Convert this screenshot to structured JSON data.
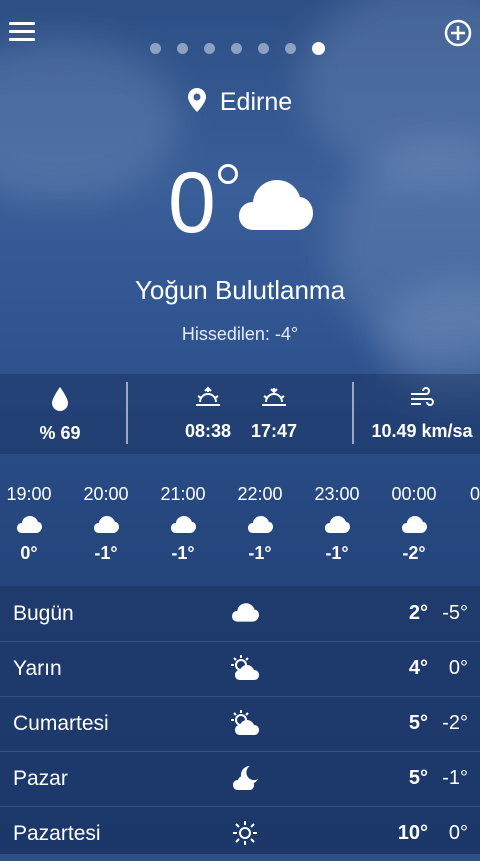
{
  "location": {
    "city": "Edirne"
  },
  "current": {
    "temperature": "0",
    "condition": "Yoğun Bulutlanma",
    "feels_like": "Hissedilen: -4°",
    "icon": "cloud-icon"
  },
  "pager": {
    "count": 7,
    "active_index": 6
  },
  "stats": {
    "humidity": "% 69",
    "sunrise": "08:38",
    "sunset": "17:47",
    "wind": "10.49 km/sa"
  },
  "hourly": [
    {
      "time": "19:00",
      "temp": "0°",
      "icon": "cloud-icon"
    },
    {
      "time": "20:00",
      "temp": "-1°",
      "icon": "cloud-icon"
    },
    {
      "time": "21:00",
      "temp": "-1°",
      "icon": "cloud-icon"
    },
    {
      "time": "22:00",
      "temp": "-1°",
      "icon": "cloud-icon"
    },
    {
      "time": "23:00",
      "temp": "-1°",
      "icon": "cloud-icon"
    },
    {
      "time": "00:00",
      "temp": "-2°",
      "icon": "cloud-icon"
    },
    {
      "time": "0",
      "temp": "",
      "icon": ""
    }
  ],
  "daily": [
    {
      "day": "Bugün",
      "hi": "2°",
      "lo": "-5°",
      "icon": "cloud-icon"
    },
    {
      "day": "Yarın",
      "hi": "4°",
      "lo": "0°",
      "icon": "sun-cloud-icon"
    },
    {
      "day": "Cumartesi",
      "hi": "5°",
      "lo": "-2°",
      "icon": "sun-cloud-icon"
    },
    {
      "day": "Pazar",
      "hi": "5°",
      "lo": "-1°",
      "icon": "moon-cloud-icon"
    },
    {
      "day": "Pazartesi",
      "hi": "10°",
      "lo": "0°",
      "icon": "sun-icon"
    }
  ]
}
